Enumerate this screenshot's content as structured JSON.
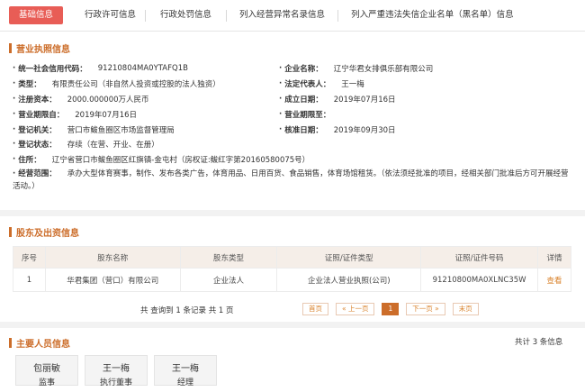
{
  "tabs": [
    "基础信息",
    "行政许可信息",
    "行政处罚信息",
    "列入经营异常名录信息",
    "列入严重违法失信企业名单（黑名单）信息"
  ],
  "license": {
    "section_title": "营业执照信息",
    "fields": [
      {
        "label": "统一社会信用代码：",
        "value": "91210804MA0YTAFQ1B"
      },
      {
        "label": "企业名称：",
        "value": "辽宁华君女排俱乐部有限公司"
      },
      {
        "label": "类型：",
        "value": "有限责任公司（非自然人投资或控股的法人独资）"
      },
      {
        "label": "法定代表人：",
        "value": "王一梅"
      },
      {
        "label": "注册资本：",
        "value": "2000.000000万人民币"
      },
      {
        "label": "成立日期：",
        "value": "2019年07月16日"
      },
      {
        "label": "营业期限自：",
        "value": "2019年07月16日"
      },
      {
        "label": "营业期限至：",
        "value": ""
      },
      {
        "label": "登记机关：",
        "value": "营口市鲅鱼圈区市场监督管理局"
      },
      {
        "label": "核准日期：",
        "value": "2019年09月30日"
      },
      {
        "label": "登记状态：",
        "value": "存续（在营、开业、在册）"
      },
      {
        "label": "住所：",
        "value": "辽宁省营口市鲅鱼圈区红旗镇-金屯村（房权证:鲅红字第20160580075号）"
      }
    ],
    "scope_label": "经营范围：",
    "scope_value": "承办大型体育赛事，制作、发布各类广告，体育用品、日用百货、食品销售，体育场馆租赁。（依法须经批准的项目，经相关部门批准后方可开展经营活动。）"
  },
  "shareholders": {
    "section_title": "股东及出资信息",
    "headers": [
      "序号",
      "股东名称",
      "股东类型",
      "证照/证件类型",
      "证照/证件号码",
      "详情"
    ],
    "rows": [
      [
        "1",
        "华君集团（营口）有限公司",
        "企业法人",
        "企业法人营业执照(公司)",
        "91210800MA0XLNC35W",
        "查看"
      ]
    ],
    "count_text": "共 查询到 1 条记录 共 1 页",
    "pager": [
      "首页",
      "« 上一页",
      "1",
      "下一页 »",
      "末页"
    ]
  },
  "people": {
    "section_title": "主要人员信息",
    "total_text": "共计 3 条信息",
    "items": [
      {
        "name": "包丽敏",
        "role": "监事"
      },
      {
        "name": "王一梅",
        "role": "执行董事"
      },
      {
        "name": "王一梅",
        "role": "经理"
      }
    ]
  },
  "colors": {
    "accent": "#cc6d2a",
    "active_tab": "#e85d56"
  }
}
